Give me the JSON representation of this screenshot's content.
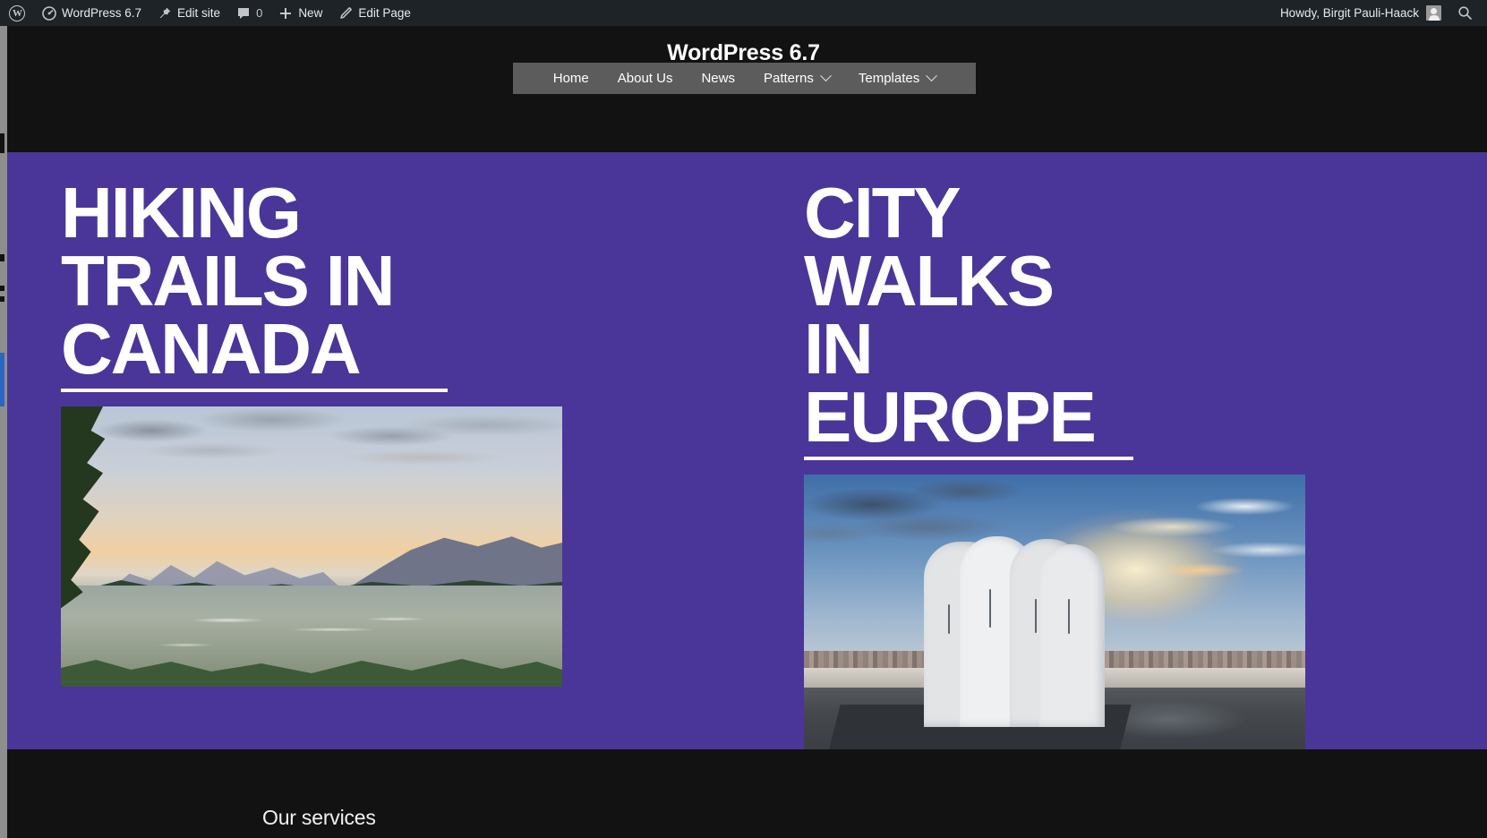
{
  "adminbar": {
    "logo_icon": "wordpress-logo-icon",
    "items": [
      {
        "icon": "dashboard-icon",
        "label": "WordPress 6.7"
      },
      {
        "icon": "pin-icon",
        "label": "Edit site"
      },
      {
        "icon": "comment-bubble-icon",
        "label": "0"
      },
      {
        "icon": "plus-icon",
        "label": "New"
      },
      {
        "icon": "pencil-icon",
        "label": "Edit Page"
      }
    ],
    "howdy": "Howdy, Birgit Pauli-Haack",
    "avatar_icon": "user-avatar-icon",
    "search_icon": "search-icon"
  },
  "header": {
    "site_title": "WordPress 6.7",
    "nav": [
      {
        "label": "Home",
        "has_submenu": false
      },
      {
        "label": "About Us",
        "has_submenu": false
      },
      {
        "label": "News",
        "has_submenu": false
      },
      {
        "label": "Patterns",
        "has_submenu": true
      },
      {
        "label": "Templates",
        "has_submenu": true
      }
    ],
    "nav_background": "#5c5c5c",
    "background": "#121212"
  },
  "hero": {
    "background": "#4a3699",
    "columns": [
      {
        "heading": "HIKING TRAILS IN CANADA",
        "image_alt": "coastal-inlet-sunset-photo"
      },
      {
        "heading": "CITY WALKS IN EUROPE",
        "image_alt": "city-sculpture-sunset-photo"
      }
    ]
  },
  "bottom": {
    "heading": "Our services",
    "background": "#121212"
  }
}
